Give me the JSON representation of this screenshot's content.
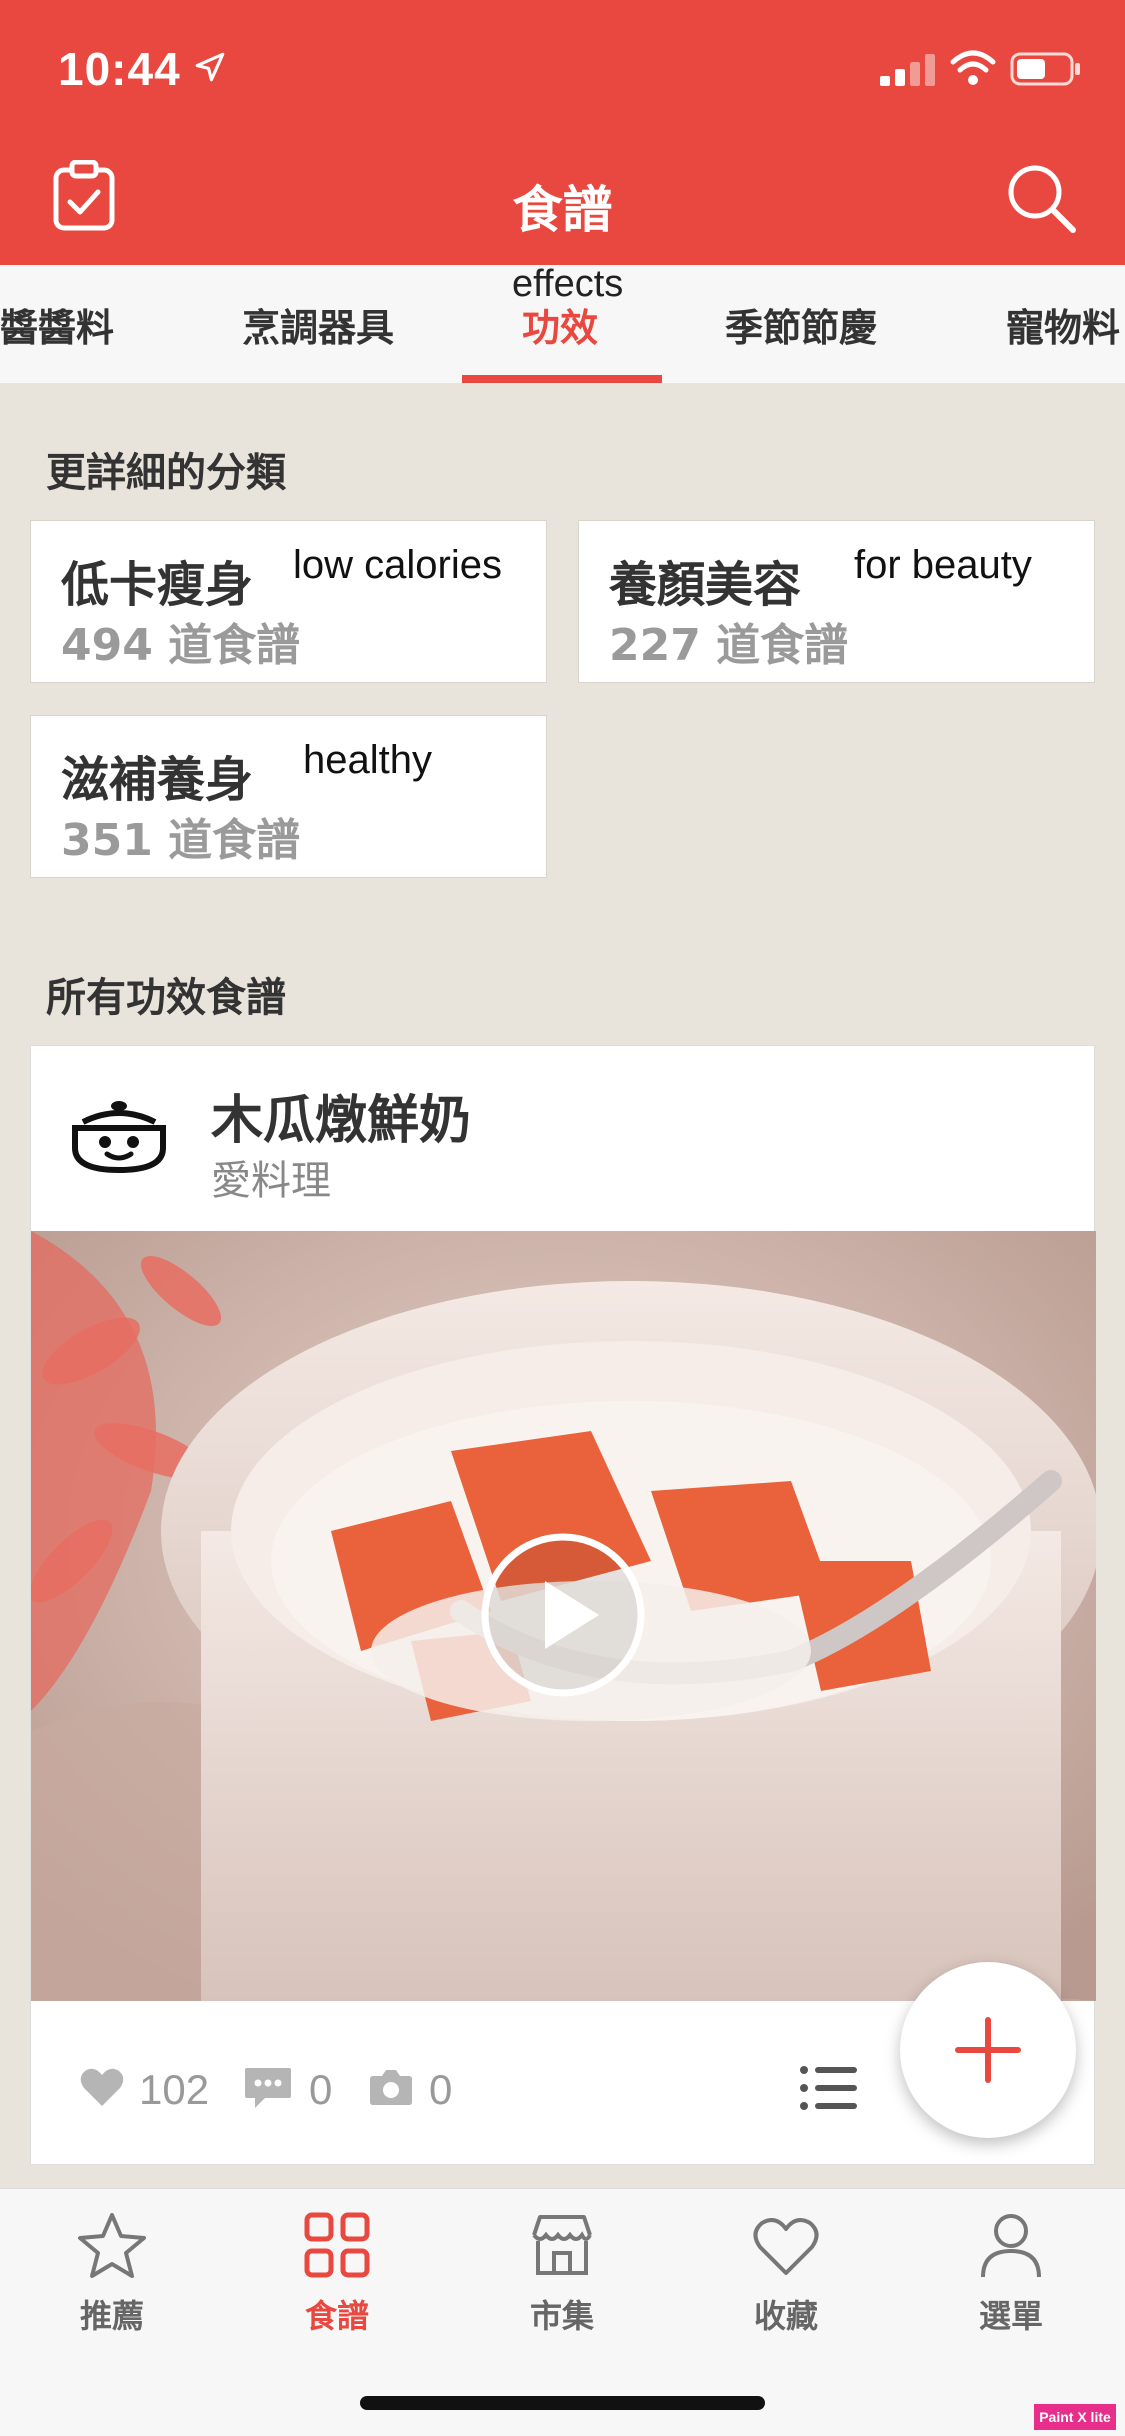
{
  "status": {
    "time": "10:44"
  },
  "header": {
    "title": "食譜"
  },
  "tabs": [
    {
      "label": "醬醬料"
    },
    {
      "label": "烹調器具"
    },
    {
      "label": "功效"
    },
    {
      "label": "季節節慶"
    },
    {
      "label": "寵物料"
    }
  ],
  "annotation": {
    "effects": "effects"
  },
  "sections": {
    "categories_title": "更詳細的分類",
    "all_title": "所有功效食譜"
  },
  "categories": [
    {
      "name": "低卡瘦身",
      "count": "494 道食譜",
      "en": "low calories"
    },
    {
      "name": "養顏美容",
      "count": "227 道食譜",
      "en": "for beauty"
    },
    {
      "name": "滋補養身",
      "count": "351 道食譜",
      "en": "healthy"
    }
  ],
  "recipe": {
    "title": "木瓜燉鮮奶",
    "author": "愛料理",
    "likes": "102",
    "comments": "0",
    "photos": "0"
  },
  "nav": [
    {
      "label": "推薦",
      "icon": "star-icon"
    },
    {
      "label": "食譜",
      "icon": "grid-icon"
    },
    {
      "label": "市集",
      "icon": "store-icon"
    },
    {
      "label": "收藏",
      "icon": "heart-icon"
    },
    {
      "label": "選單",
      "icon": "person-icon"
    }
  ],
  "watermark": "Paint X lite",
  "colors": {
    "accent": "#e8483f",
    "background": "#e8e4dc"
  }
}
